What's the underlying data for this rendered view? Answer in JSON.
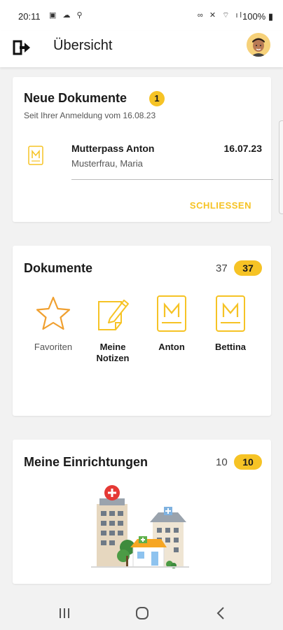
{
  "status_bar": {
    "time": "20:11",
    "battery": "100%"
  },
  "header": {
    "title": "Übersicht"
  },
  "new_documents": {
    "title": "Neue Dokumente",
    "badge": "1",
    "subtitle": "Seit Ihrer Anmeldung vom 16.08.23",
    "items": [
      {
        "name": "Mutterpass Anton",
        "sub": "Musterfrau, Maria",
        "date": "16.07.23"
      }
    ],
    "close_label": "SCHLIESSEN"
  },
  "documents": {
    "title": "Dokumente",
    "count": "37",
    "badge": "37",
    "tiles": [
      {
        "label": "Favoriten",
        "icon": "star-icon"
      },
      {
        "label": "Meine\nNotizen",
        "icon": "notes-icon"
      },
      {
        "label": "Anton",
        "icon": "mutterpass-icon"
      },
      {
        "label": "Bettina",
        "icon": "mutterpass-icon"
      }
    ]
  },
  "facilities": {
    "title": "Meine Einrichtungen",
    "count": "10",
    "badge": "10"
  },
  "colors": {
    "accent": "#f6c325",
    "star": "#f0a030",
    "background": "#f2f2f2"
  }
}
